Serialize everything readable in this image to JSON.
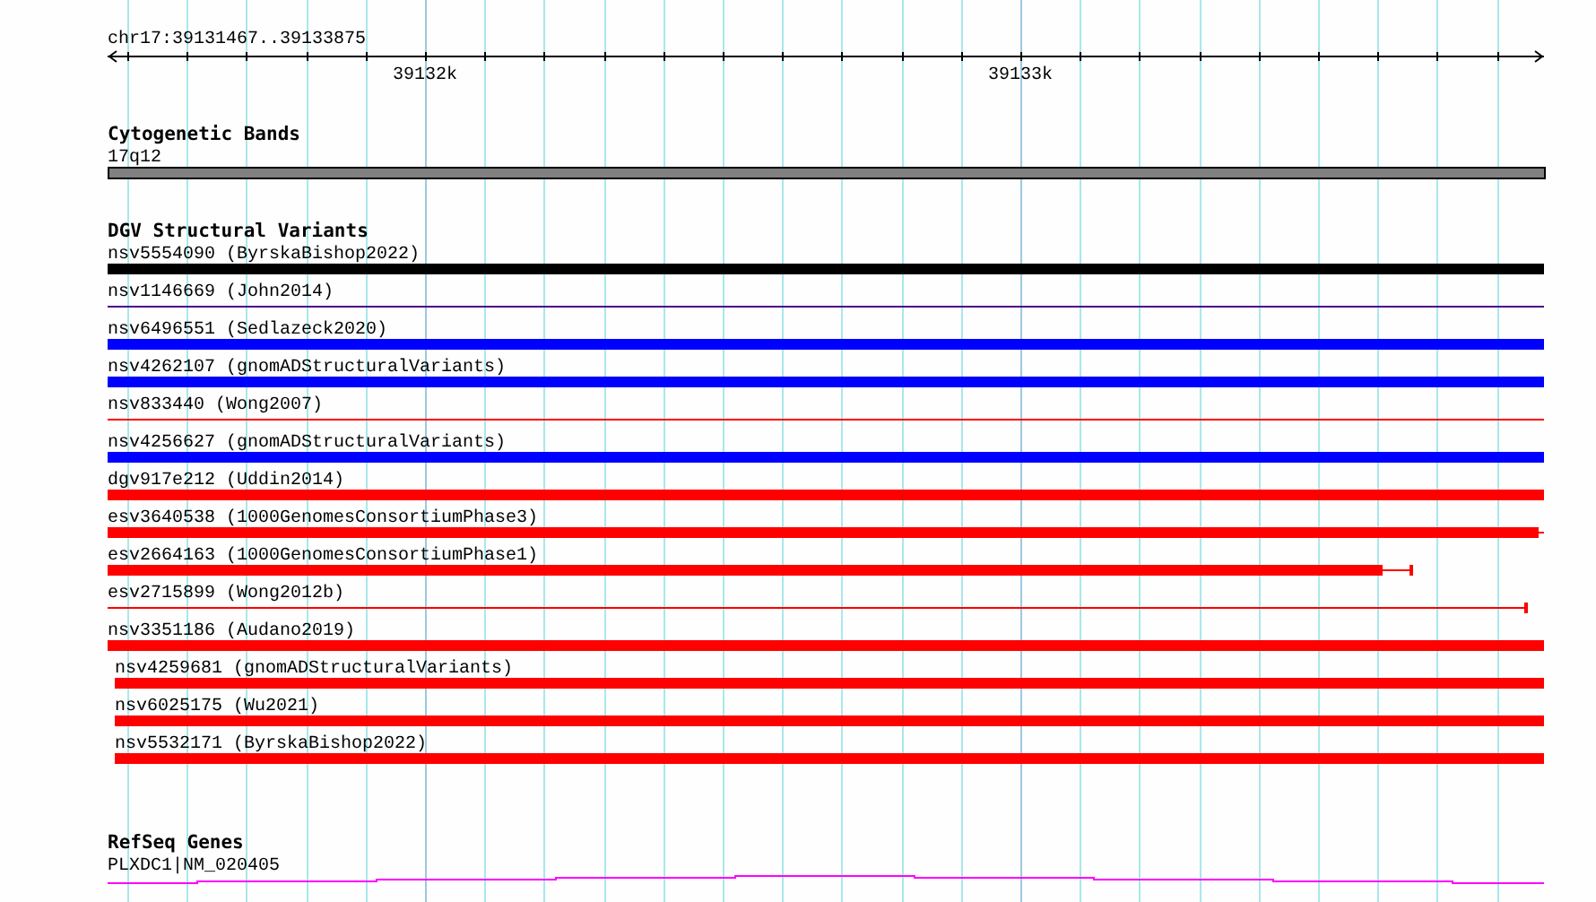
{
  "ruler": {
    "range": "chr17:39131467..39133875",
    "major_ticks": [
      "39132k",
      "39133k"
    ]
  },
  "cytogenetic_bands": {
    "title": "Cytogenetic Bands",
    "band": "17q12"
  },
  "dgv_structural_variants": {
    "title": "DGV Structural Variants",
    "variants": [
      {
        "label": "nsv5554090 (ByrskaBishop2022)",
        "kind": "thick",
        "color": "#000000",
        "indented": false
      },
      {
        "label": "nsv1146669 (John2014)",
        "kind": "thin",
        "color": "#4b0082",
        "indented": false
      },
      {
        "label": "nsv6496551 (Sedlazeck2020)",
        "kind": "thick",
        "color": "#0000ff",
        "indented": false
      },
      {
        "label": "nsv4262107 (gnomADStructuralVariants)",
        "kind": "thick",
        "color": "#0000ff",
        "indented": false
      },
      {
        "label": "nsv833440 (Wong2007)",
        "kind": "thin",
        "color": "#ff0000",
        "indented": false
      },
      {
        "label": "nsv4256627 (gnomADStructuralVariants)",
        "kind": "thick",
        "color": "#0000ff",
        "indented": false
      },
      {
        "label": "dgv917e212 (Uddin2014)",
        "kind": "thick",
        "color": "#ff0000",
        "indented": false
      },
      {
        "label": "esv3640538 (1000GenomesConsortiumPhase3)",
        "kind": "thick-tail",
        "color": "#ff0000",
        "indented": false
      },
      {
        "label": "esv2664163 (1000GenomesConsortiumPhase1)",
        "kind": "thick-whisker",
        "color": "#ff0000",
        "indented": false
      },
      {
        "label": "esv2715899 (Wong2012b)",
        "kind": "thin-capped",
        "color": "#ff0000",
        "indented": false
      },
      {
        "label": "nsv3351186 (Audano2019)",
        "kind": "thick",
        "color": "#ff0000",
        "indented": false
      },
      {
        "label": "nsv4259681 (gnomADStructuralVariants)",
        "kind": "thick",
        "color": "#ff0000",
        "indented": true
      },
      {
        "label": "nsv6025175 (Wu2021)",
        "kind": "thick",
        "color": "#ff0000",
        "indented": true
      },
      {
        "label": "nsv5532171 (ByrskaBishop2022)",
        "kind": "thick",
        "color": "#ff0000",
        "indented": true
      }
    ]
  },
  "refseq_genes": {
    "title": "RefSeq Genes",
    "gene": "PLXDC1|NM_020405"
  }
}
